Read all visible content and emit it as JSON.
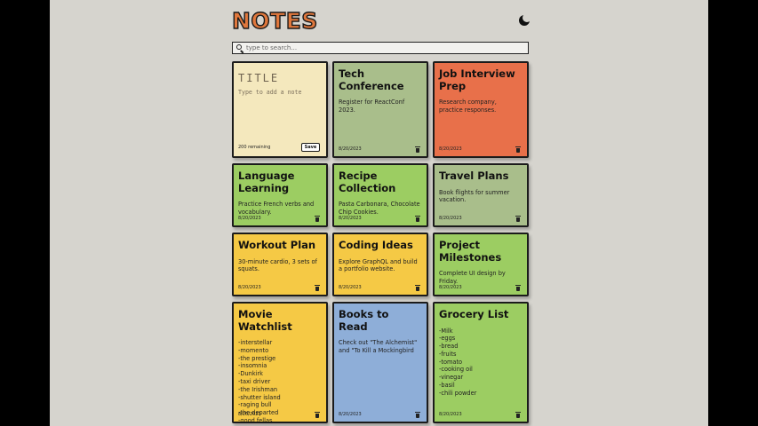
{
  "app": {
    "title": "NOTES",
    "theme_toggle_icon": "moon-icon"
  },
  "search": {
    "placeholder": "type to search...",
    "value": ""
  },
  "new_note": {
    "title_placeholder": "TITLE",
    "body_placeholder": "Type to add a note",
    "remaining_text": "200 remaining",
    "save_label": "Save",
    "color": "#f4e8bd"
  },
  "notes": [
    {
      "title": "Tech Conference",
      "body": "Register for ReactConf 2023.",
      "date": "8/20/2023",
      "color": "#a9be8b"
    },
    {
      "title": "Job Interview Prep",
      "body": "Research company, practice responses.",
      "date": "8/20/2023",
      "color": "#e8704a"
    },
    {
      "title": "Language Learning",
      "body": "Practice French verbs and vocabulary.",
      "date": "8/20/2023",
      "color": "#9ccd62"
    },
    {
      "title": "Recipe Collection",
      "body": "Pasta Carbonara, Chocolate Chip Cookies.",
      "date": "8/20/2023",
      "color": "#9ccd62"
    },
    {
      "title": "Travel Plans",
      "body": "Book flights for summer vacation.",
      "date": "8/20/2023",
      "color": "#a9be8b"
    },
    {
      "title": "Workout Plan",
      "body": "30-minute cardio, 3 sets of squats.",
      "date": "8/20/2023",
      "color": "#f5c945"
    },
    {
      "title": "Coding Ideas",
      "body": "Explore GraphQL and build a portfolio website.",
      "date": "8/20/2023",
      "color": "#f5c945"
    },
    {
      "title": "Project Milestones",
      "body": "Complete UI design by Friday.",
      "date": "8/20/2023",
      "color": "#9ccd62"
    },
    {
      "title": "Movie Watchlist",
      "body": "-interstellar\n-momento\n-the prestige\n-insomnia\n-Dunkirk\n-taxi driver\n-the Irishman\n-shutter island\n-raging bull\n-the departed\n-good fellas",
      "date": "8/20/2023",
      "color": "#f5c945"
    },
    {
      "title": "Books to Read",
      "body": "Check out \"The Alchemist\" and \"To Kill a Mockingbird",
      "date": "8/20/2023",
      "color": "#8eaed8"
    },
    {
      "title": "Grocery List",
      "body": "-Milk\n-eggs\n-bread\n-fruits\n-tomato\n-cooking oil\n-vinegar\n-basil\n-chili powder",
      "date": "8/20/2023",
      "color": "#9ccd62"
    }
  ]
}
